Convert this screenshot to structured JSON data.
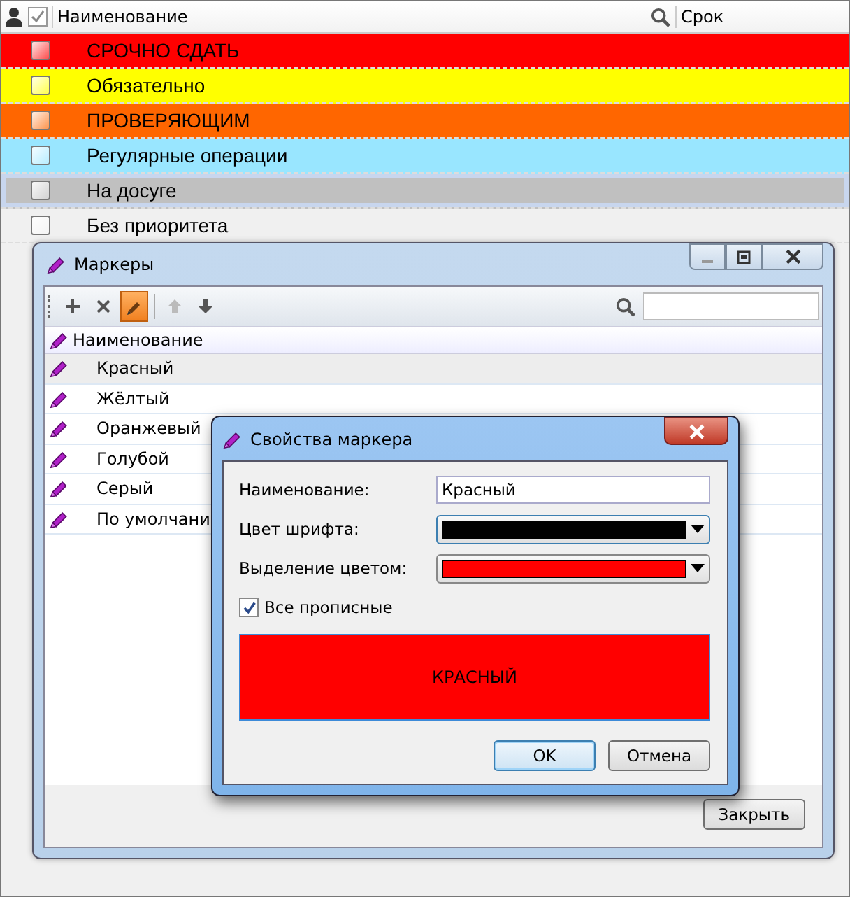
{
  "table": {
    "columns": [
      "Наименование",
      "Срок"
    ],
    "rows": [
      {
        "name": "СРОЧНО СДАТЬ",
        "color": "#ff0000",
        "checked": false,
        "selected": false
      },
      {
        "name": "Обязательно",
        "color": "#ffff00",
        "checked": false,
        "selected": false
      },
      {
        "name": "ПРОВЕРЯЮЩИМ",
        "color": "#ff6600",
        "checked": false,
        "selected": false
      },
      {
        "name": "Регулярные операции",
        "color": "#99e6ff",
        "checked": false,
        "selected": false
      },
      {
        "name": "На досуге",
        "color": "#c0c0c0",
        "checked": false,
        "selected": true
      },
      {
        "name": "Без приоритета",
        "color": "#f0f0f0",
        "checked": false,
        "selected": false
      }
    ]
  },
  "markers_window": {
    "title": "Маркеры",
    "toolbar": [
      {
        "kind": "add",
        "pressed": false,
        "disabled": false
      },
      {
        "kind": "delete",
        "pressed": false,
        "disabled": false
      },
      {
        "kind": "edit",
        "pressed": true,
        "disabled": false
      },
      {
        "kind": "up",
        "pressed": false,
        "disabled": true
      },
      {
        "kind": "down",
        "pressed": false,
        "disabled": false
      }
    ],
    "column": "Наименование",
    "items": [
      {
        "name": "Красный",
        "selected": true
      },
      {
        "name": "Жёлтый",
        "selected": false
      },
      {
        "name": "Оранжевый",
        "selected": false
      },
      {
        "name": "Голубой",
        "selected": false
      },
      {
        "name": "Серый",
        "selected": false
      },
      {
        "name": "По умолчани",
        "selected": false
      }
    ],
    "close_button": "Закрыть"
  },
  "dialog": {
    "title": "Свойства маркера",
    "name_label": "Наименование:",
    "name_value": "Красный",
    "font_color": {
      "label": "Цвет шрифта:",
      "color": "#000000"
    },
    "highlight": {
      "label": "Выделение цветом:",
      "color": "#ff0000"
    },
    "uppercase_label": "Все прописные",
    "uppercase_checked": true,
    "preview": "КРАСНЫЙ",
    "buttons": [
      "OK",
      "Отмена"
    ]
  }
}
